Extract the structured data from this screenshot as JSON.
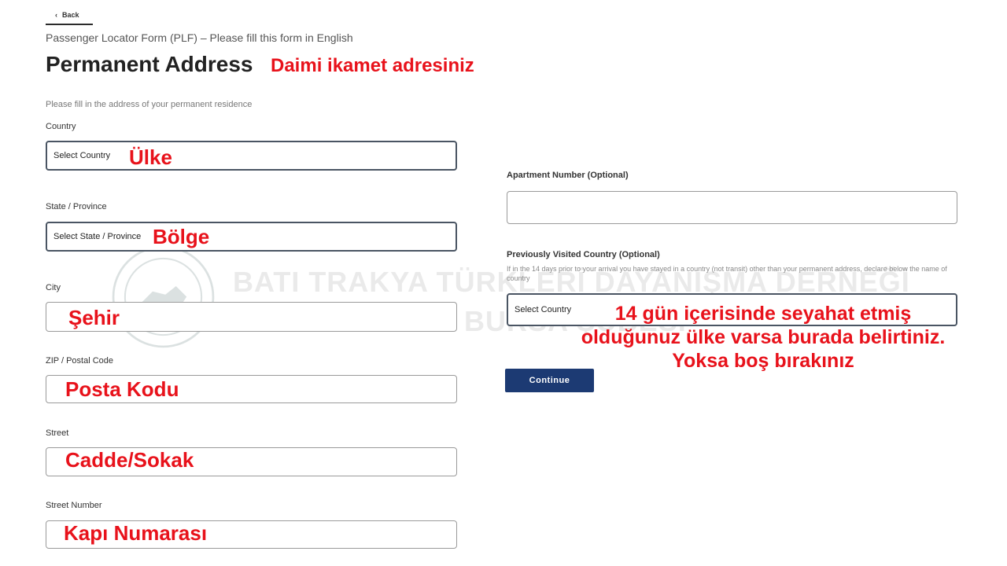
{
  "nav": {
    "back_label": "Back"
  },
  "form_context": "Passenger Locator Form (PLF) – Please fill this form in English",
  "title": "Permanent Address",
  "title_annotation": "Daimi ikamet adresiniz",
  "instruction": "Please fill in the address of your permanent residence",
  "left_fields": {
    "country": {
      "label": "Country",
      "value": "Select Country",
      "annotation": "Ülke"
    },
    "state": {
      "label": "State / Province",
      "value": "Select State / Province",
      "annotation": "Bölge"
    },
    "city": {
      "label": "City",
      "value": "",
      "annotation": "Şehir"
    },
    "zip": {
      "label": "ZIP / Postal Code",
      "value": "",
      "annotation": "Posta Kodu"
    },
    "street": {
      "label": "Street",
      "value": "",
      "annotation": "Cadde/Sokak"
    },
    "street_number": {
      "label": "Street Number",
      "value": "",
      "annotation": "Kapı Numarası"
    }
  },
  "right_fields": {
    "apartment": {
      "label": "Apartment Number (Optional)",
      "value": ""
    },
    "visited_country": {
      "label": "Previously Visited Country (Optional)",
      "helper": "If in the 14 days prior to your arrival you have stayed in a country (not transit) other than your permanent address, declare below the name of country",
      "value": "Select Country",
      "annotation_lines": [
        "14 gün içerisinde seyahat etmiş",
        "olduğunuz ülke varsa burada belirtiniz.",
        "Yoksa boş bırakınız"
      ]
    }
  },
  "continue_label": "Continue",
  "watermark": {
    "line1": "BATI TRAKYA TÜRKLERİ DAYANIŞMA DERNEĞİ",
    "line2": "BURSA ŞUBESİ"
  },
  "colors": {
    "annotation": "#e8121b",
    "button": "#1c3a73",
    "field_border": "#4a5563"
  }
}
